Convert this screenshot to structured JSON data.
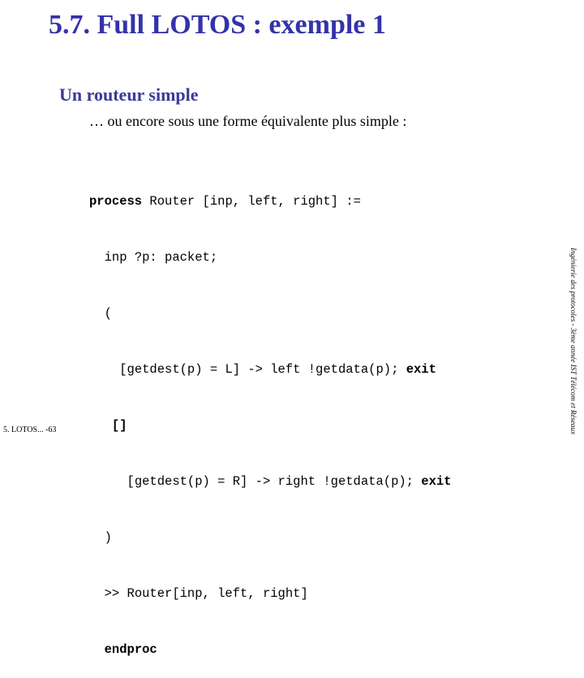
{
  "slide": {
    "title": "5.7. Full LOTOS : exemple 1",
    "subtitle": "Un routeur simple",
    "intro": "… ou encore sous une forme équivalente plus simple :"
  },
  "code": {
    "lines": [
      {
        "indent": "",
        "kw_before": "process",
        "text": " Router [inp, left, right] :=",
        "kw_after": ""
      },
      {
        "indent": "  ",
        "kw_before": "",
        "text": "inp ?p: packet;",
        "kw_after": ""
      },
      {
        "indent": "  ",
        "kw_before": "",
        "text": "(",
        "kw_after": ""
      },
      {
        "indent": "    ",
        "kw_before": "",
        "text": "[getdest(p) = L] -> left !getdata(p); ",
        "kw_after": "exit"
      },
      {
        "indent": "   ",
        "kw_before": "[]",
        "text": "",
        "kw_after": ""
      },
      {
        "indent": "     ",
        "kw_before": "",
        "text": "[getdest(p) = R] -> right !getdata(p); ",
        "kw_after": "exit"
      },
      {
        "indent": "  ",
        "kw_before": "",
        "text": ")",
        "kw_after": ""
      },
      {
        "indent": "  ",
        "kw_before": "",
        "text": ">> Router[inp, left, right]",
        "kw_after": ""
      },
      {
        "indent": "  ",
        "kw_before": "endproc",
        "text": "",
        "kw_after": ""
      }
    ]
  },
  "side_note": "Ingénierie des protocoles - 3ème année IST Télécom et Réseaux",
  "footer": "5. LOTOS... -63",
  "colors": {
    "title": "#3333aa",
    "subtitle": "#3a3a9a",
    "text": "#000000"
  }
}
